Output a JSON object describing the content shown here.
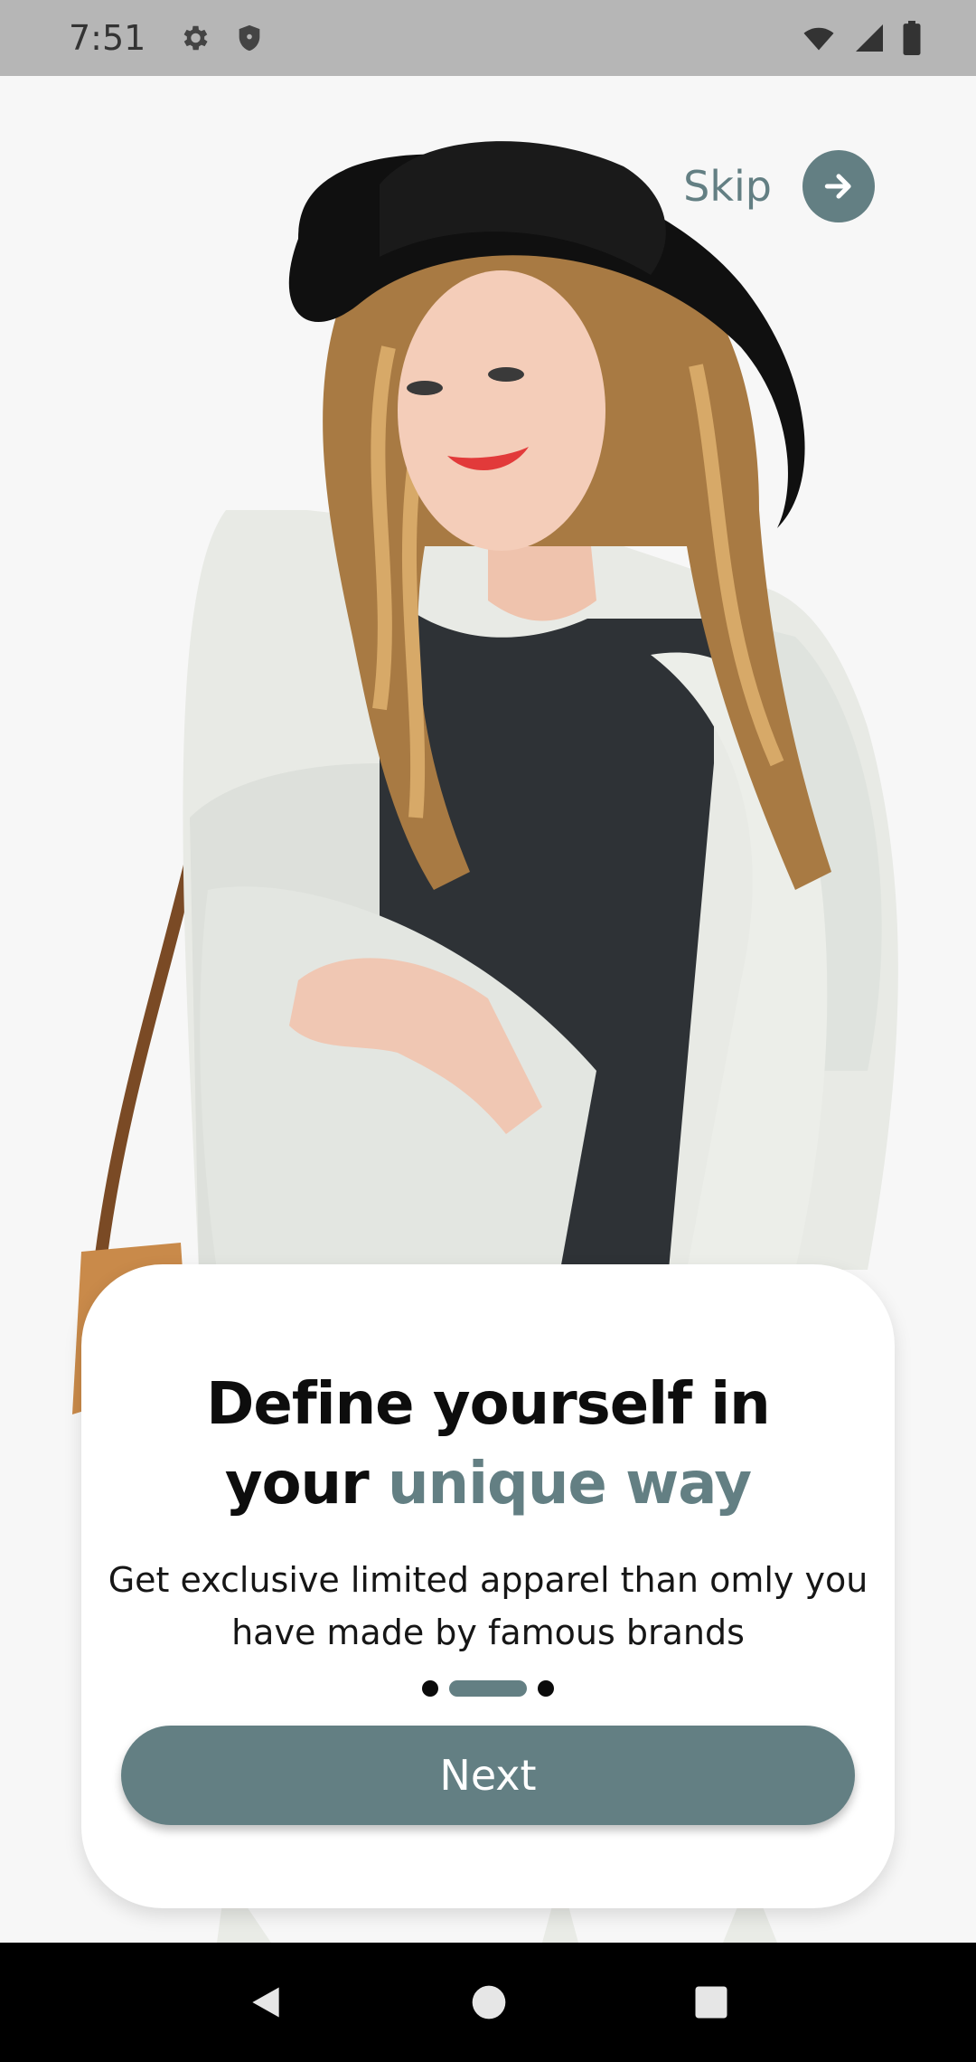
{
  "status_bar": {
    "time": "7:51",
    "icons": [
      "gear-icon",
      "shield-icon",
      "wifi-icon",
      "signal-icon",
      "battery-icon"
    ]
  },
  "header": {
    "skip_label": "Skip",
    "skip_icon": "arrow-right-icon"
  },
  "onboarding": {
    "title_line1": "Define yourself in",
    "title_line2_prefix": "your ",
    "title_line2_accent": "unique way",
    "subtitle": "Get exclusive limited apparel than omly you have made by famous brands",
    "page_indicator": {
      "count": 3,
      "active_index": 1
    },
    "next_label": "Next"
  },
  "colors": {
    "accent": "#637f83",
    "card_bg": "#ffffff",
    "status_bar_bg": "#b6b6b6",
    "nav_bar_bg": "#000000"
  },
  "nav_bar": {
    "icons": [
      "back-icon",
      "home-icon",
      "recents-icon"
    ]
  }
}
